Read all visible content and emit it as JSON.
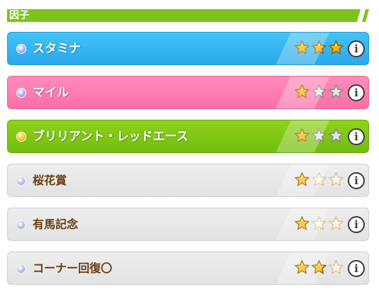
{
  "section": {
    "title": "因子"
  },
  "factors": [
    {
      "label": "スタミナ",
      "stars": 3,
      "max_stars": 3,
      "info_icon": "info-icon"
    },
    {
      "label": "マイル",
      "stars": 1,
      "max_stars": 3,
      "info_icon": "info-icon"
    },
    {
      "label": "ブリリアント・レッドエース",
      "stars": 1,
      "max_stars": 3,
      "info_icon": "info-icon"
    },
    {
      "label": "桜花賞",
      "stars": 1,
      "max_stars": 3,
      "info_icon": "info-icon"
    },
    {
      "label": "有馬記念",
      "stars": 1,
      "max_stars": 3,
      "info_icon": "info-icon"
    },
    {
      "label": "コーナー回復〇",
      "stars": 2,
      "max_stars": 3,
      "info_icon": "info-icon"
    }
  ],
  "info_glyph": "i",
  "colors": {
    "stamina": "#2aa8ec",
    "aptitude": "#fb6fa6",
    "unique": "#72bd12",
    "race_skill": "#e2e2e2",
    "star_gold": "#f5b800"
  }
}
